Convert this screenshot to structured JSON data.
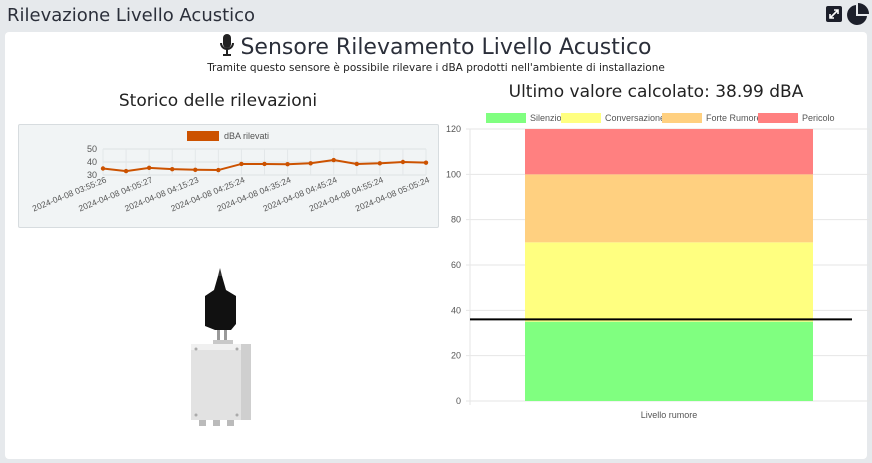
{
  "app": {
    "title": "Rilevazione Livello Acustico"
  },
  "header": {
    "title": "Sensore Rilevamento Livello Acustico",
    "subtitle": "Tramite questo sensore è possibile rilevare i dBA prodotti nell'ambiente di installazione",
    "icon": "microphone-icon"
  },
  "toolbar": {
    "expand_icon": "expand-icon",
    "chart_icon": "pie-chart-icon"
  },
  "history": {
    "title": "Storico delle rilevazioni"
  },
  "level": {
    "title": "Ultimo valore calcolato: 38.99 dBA"
  },
  "colors": {
    "line": "#cc5200",
    "silenzio": "#80ff80",
    "conversazione": "#ffff80",
    "forte": "#ffd080",
    "pericolo": "#ff8080"
  },
  "chart_data": [
    {
      "type": "line",
      "title": "",
      "xlabel": "",
      "ylabel": "",
      "legend": "top",
      "grid": true,
      "ylim": [
        30,
        50
      ],
      "yticks": [
        30,
        40,
        50
      ],
      "series": [
        {
          "name": "dBA rilevati",
          "values": [
            35,
            33,
            35.5,
            34.5,
            34,
            33.8,
            38.5,
            38.5,
            38.3,
            39,
            41.5,
            38.5,
            39,
            40,
            39.5
          ]
        }
      ],
      "x": [
        "2024-04-08 03:55:26",
        "",
        "2024-04-08 04:05:27",
        "",
        "2024-04-08 04:15:23",
        "",
        "2024-04-08 04:25:24",
        "",
        "2024-04-08 04:35:24",
        "",
        "2024-04-08 04:45:24",
        "",
        "2024-04-08 04:55:24",
        "",
        "2024-04-08 05:05:24"
      ],
      "xtick_labels": [
        "2024-04-08 03:55:26",
        "2024-04-08 04:05:27",
        "2024-04-08 04:15:23",
        "2024-04-08 04:25:24",
        "2024-04-08 04:35:24",
        "2024-04-08 04:45:24",
        "2024-04-08 04:55:24",
        "2024-04-08 05:05:24"
      ]
    },
    {
      "type": "bar",
      "stacked": true,
      "categories": [
        "Livello rumore"
      ],
      "ylim": [
        0,
        120
      ],
      "yticks": [
        0,
        20,
        40,
        60,
        80,
        100,
        120
      ],
      "legend": "top",
      "grid": true,
      "series": [
        {
          "name": "Silenzio",
          "values": [
            35
          ]
        },
        {
          "name": "Conversazione",
          "values": [
            35
          ]
        },
        {
          "name": "Forte Rumore",
          "values": [
            30
          ]
        },
        {
          "name": "Pericolo",
          "values": [
            20
          ]
        }
      ],
      "annotation": {
        "value": 36
      }
    }
  ]
}
